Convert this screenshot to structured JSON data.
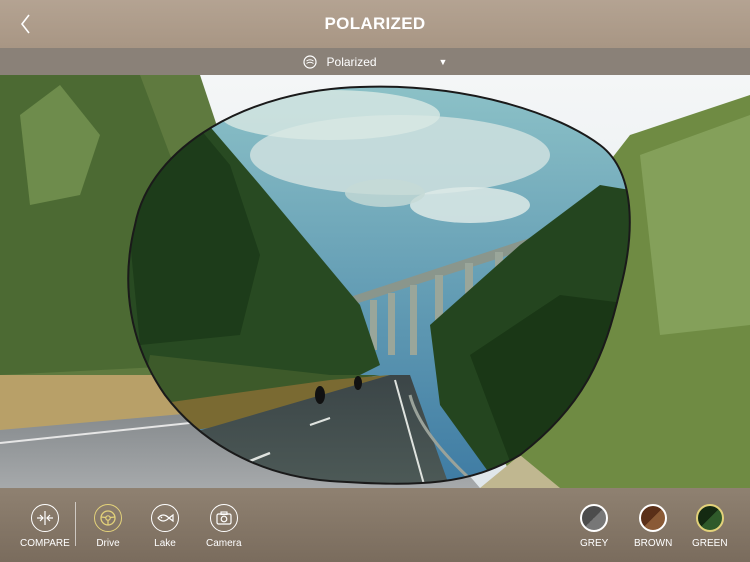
{
  "header": {
    "title": "POLARIZED",
    "back_icon": "chevron-left-icon"
  },
  "selector": {
    "value": "Polarized",
    "icon": "lens-logo-icon",
    "caret": "▼"
  },
  "toolbar": {
    "compare_label": "COMPARE",
    "modes": [
      {
        "label": "Drive",
        "icon": "steering-wheel-icon",
        "active": true
      },
      {
        "label": "Lake",
        "icon": "fish-icon",
        "active": false
      },
      {
        "label": "Camera",
        "icon": "camera-icon",
        "active": false
      }
    ],
    "tints": [
      {
        "label": "GREY",
        "color": "#5a5a5a"
      },
      {
        "label": "BROWN",
        "color": "#6e3f22"
      },
      {
        "label": "GREEN",
        "color": "#1f3a1c"
      }
    ]
  },
  "colors": {
    "header_bg": "#ab9987",
    "toolbar_bg": "#857767",
    "active_accent": "#e3d27a"
  }
}
